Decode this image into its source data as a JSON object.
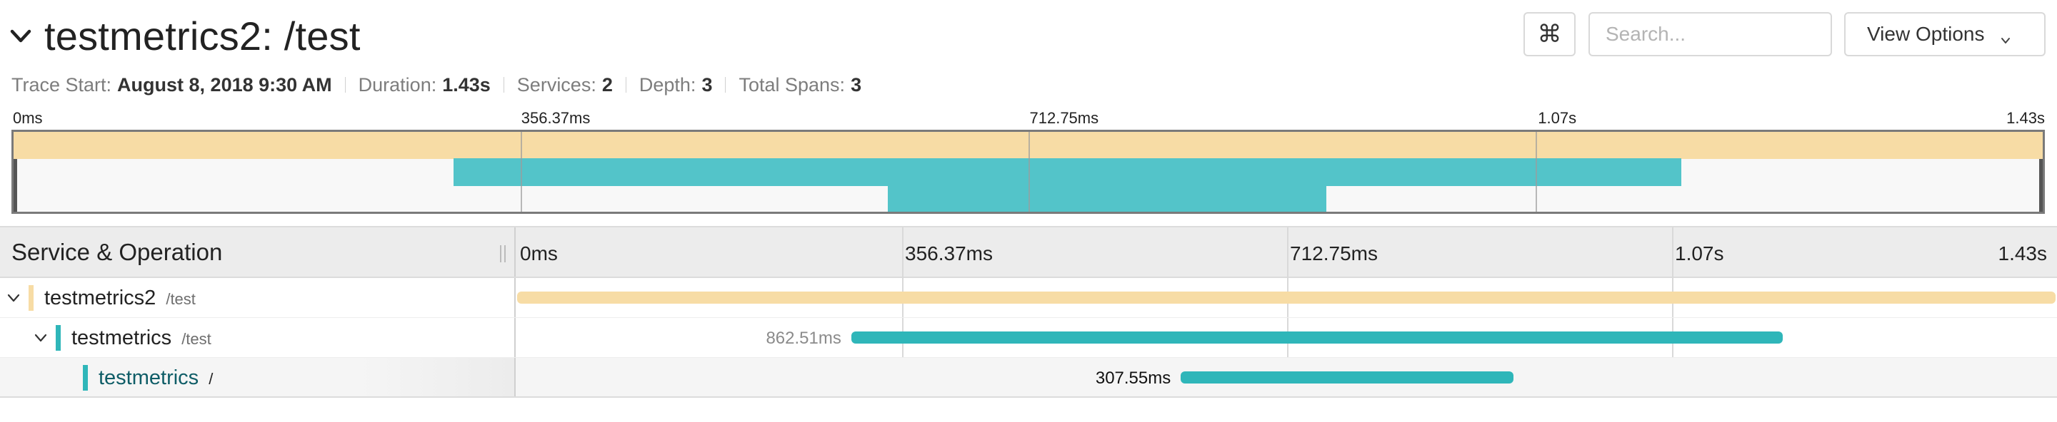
{
  "header": {
    "title": "testmetrics2: /test",
    "cmd_glyph": "⌘",
    "search_placeholder": "Search...",
    "view_options_label": "View Options"
  },
  "meta": {
    "trace_start_label": "Trace Start:",
    "trace_start_value": "August 8, 2018 9:30 AM",
    "duration_label": "Duration:",
    "duration_value": "1.43s",
    "services_label": "Services:",
    "services_value": "2",
    "depth_label": "Depth:",
    "depth_value": "3",
    "total_spans_label": "Total Spans:",
    "total_spans_value": "3"
  },
  "minimap": {
    "ticks": [
      "0ms",
      "356.37ms",
      "712.75ms",
      "1.07s",
      "1.43s"
    ]
  },
  "timeline": {
    "column_header": "Service & Operation",
    "ticks": [
      "0ms",
      "356.37ms",
      "712.75ms",
      "1.07s",
      "1.43s"
    ]
  },
  "spans": [
    {
      "service": "testmetrics2",
      "operation": "/test",
      "depth": 0,
      "expanded": true,
      "start_fraction": 0.0,
      "end_fraction": 1.0,
      "duration_label": ""
    },
    {
      "service": "testmetrics",
      "operation": "/test",
      "depth": 1,
      "expanded": true,
      "start_fraction": 0.217,
      "end_fraction": 0.822,
      "duration_label": "862.51ms"
    },
    {
      "service": "testmetrics",
      "operation": "/",
      "depth": 2,
      "expanded": false,
      "start_fraction": 0.431,
      "end_fraction": 0.647,
      "duration_label": "307.55ms"
    }
  ],
  "colors": {
    "testmetrics2": "#f7dca5",
    "testmetrics": "#2fb6b9",
    "testmetrics_minimap": "#53c4c9"
  },
  "icons": {
    "title_toggle": "chevron-down-icon",
    "keyboard": "command-key-icon",
    "view_options_caret": "chevron-down-icon",
    "row_toggle": "chevron-down-icon"
  }
}
